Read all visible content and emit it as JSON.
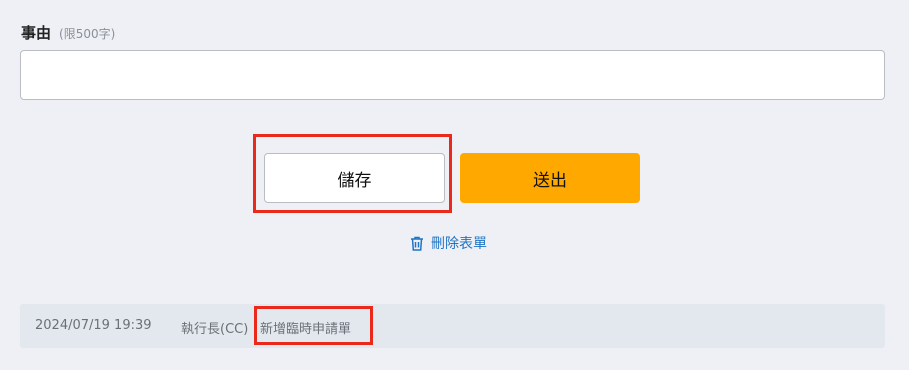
{
  "form": {
    "reason_label": "事由",
    "reason_hint": "(限500字)",
    "reason_value": ""
  },
  "actions": {
    "save_label": "儲存",
    "submit_label": "送出",
    "delete_label": "刪除表單",
    "delete_icon": "trash-icon"
  },
  "colors": {
    "submit_bg": "#ffa800",
    "link": "#1f74c4",
    "highlight": "#e8291c",
    "page_bg": "#eef0f5",
    "log_bg": "#e3e8ee"
  },
  "log": {
    "timestamp": "2024/07/19 19:39",
    "user": "執行長(CC)",
    "action": "新增臨時申請單"
  }
}
